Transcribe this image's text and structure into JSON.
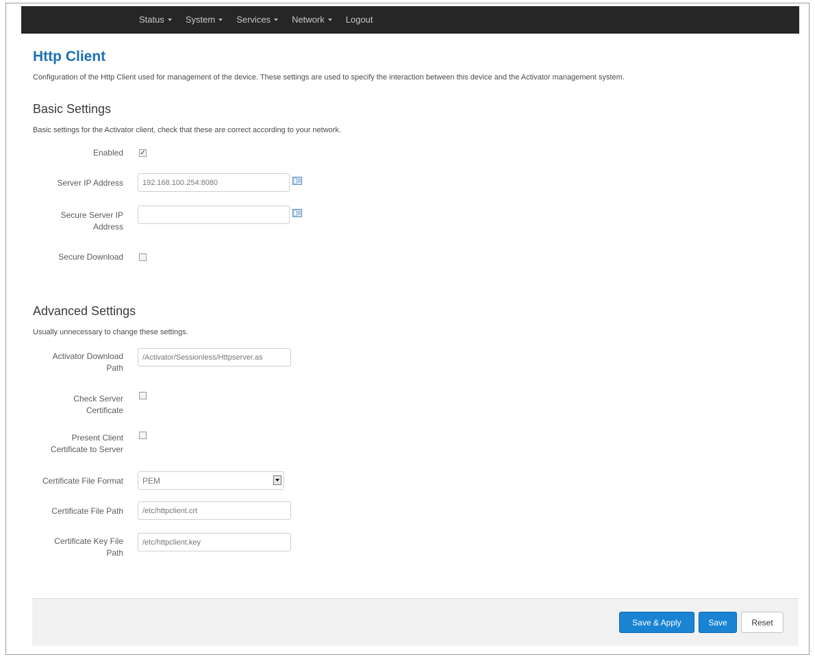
{
  "nav": {
    "items": [
      {
        "label": "Status",
        "dropdown": true
      },
      {
        "label": "System",
        "dropdown": true
      },
      {
        "label": "Services",
        "dropdown": true
      },
      {
        "label": "Network",
        "dropdown": true
      },
      {
        "label": "Logout",
        "dropdown": false
      }
    ]
  },
  "page": {
    "title": "Http Client",
    "description": "Configuration of the Http Client used for management of the device. These settings are used to specify the interaction between this device and the Activator management system."
  },
  "basic": {
    "title": "Basic Settings",
    "description": "Basic settings for the Activator client, check that these are correct according to your network.",
    "enabled_label": "Enabled",
    "enabled_checked": true,
    "server_ip_label": "Server IP Address",
    "server_ip_value": "192.168.100.254:8080",
    "secure_ip_label": "Secure Server IP Address",
    "secure_ip_value": "",
    "secure_download_label": "Secure Download",
    "secure_download_checked": false
  },
  "advanced": {
    "title": "Advanced Settings",
    "description": "Usually unnecessary to change these settings.",
    "download_path_label": "Activator Download Path",
    "download_path_value": "/Activator/Sessionless/Httpserver.as",
    "check_cert_label": "Check Server Certificate",
    "check_cert_checked": false,
    "present_cert_label": "Present Client Certificate to Server",
    "present_cert_checked": false,
    "cert_format_label": "Certificate File Format",
    "cert_format_value": "PEM",
    "cert_path_label": "Certificate File Path",
    "cert_path_value": "/etc/httpclient.crt",
    "key_path_label": "Certificate Key File Path",
    "key_path_value": "/etc/httpclient.key"
  },
  "footer": {
    "save_apply": "Save & Apply",
    "save": "Save",
    "reset": "Reset"
  },
  "colors": {
    "title_blue": "#1c6fb5",
    "primary_button": "#1a84d2",
    "navbar": "#262626"
  }
}
